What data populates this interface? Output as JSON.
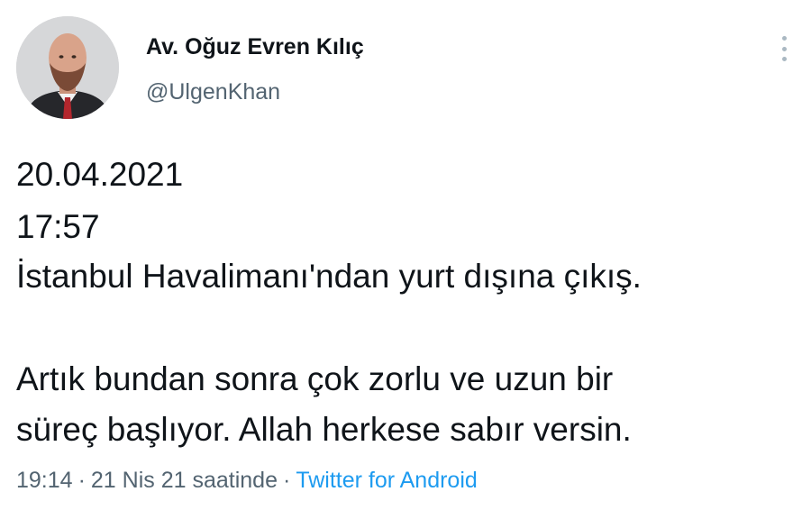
{
  "author": {
    "display_name": "Av. Oğuz Evren Kılıç",
    "handle": "@UlgenKhan"
  },
  "tweet": {
    "lines": [
      "20.04.2021",
      "17:57",
      "İstanbul Havalimanı'ndan yurt dışına çıkış.",
      "Artık bundan sonra çok zorlu ve uzun bir",
      "süreç başlıyor. Allah herkese sabır versin."
    ]
  },
  "meta": {
    "time": "19:14",
    "separator": "·",
    "date": "21 Nis 21 saatinde",
    "source": "Twitter for Android"
  },
  "icons": {
    "more": "more-vertical-icon"
  },
  "colors": {
    "text": "#0f1419",
    "secondary": "#536471",
    "link": "#1d9bf0"
  }
}
